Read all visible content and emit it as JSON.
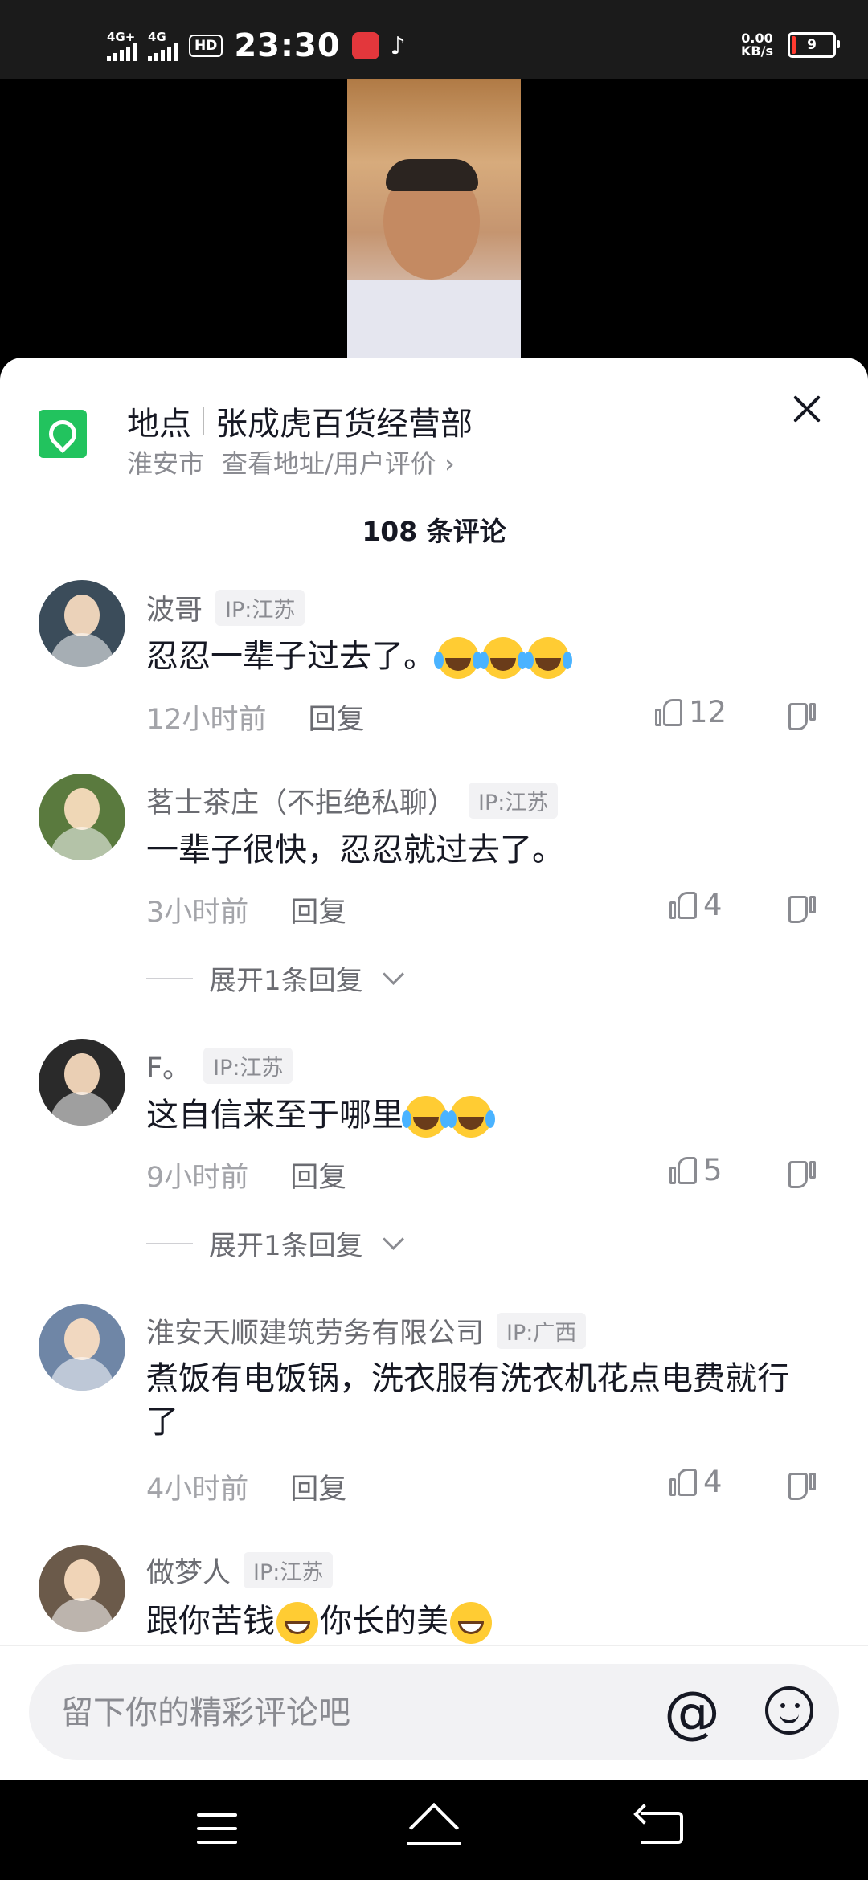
{
  "status_bar": {
    "signal1_label": "4G+",
    "signal2_label": "4G",
    "hd_label": "HD",
    "time": "23:30",
    "net_speed_value": "0.00",
    "net_speed_unit": "KB/s",
    "battery_level": "9"
  },
  "location": {
    "label": "地点",
    "name": "张成虎百货经营部",
    "city": "淮安市",
    "detail_link": "查看地址/用户评价",
    "chevron": "›",
    "icon": "location-pin-icon",
    "icon_color": "#22c35e"
  },
  "comments_count": "108 条评论",
  "comments": [
    {
      "user": "波哥",
      "ip": "IP:江苏",
      "text": "忍忍一辈子过去了。",
      "emoji": [
        "cry",
        "cry",
        "cry"
      ],
      "time": "12小时前",
      "reply_label": "回复",
      "likes": "12",
      "avatar_color": "#3b4c5a"
    },
    {
      "user": "茗士茶庄（不拒绝私聊）",
      "ip": "IP:江苏",
      "text": "一辈子很快，忍忍就过去了。",
      "emoji": [],
      "time": "3小时前",
      "reply_label": "回复",
      "likes": "4",
      "expand": "展开1条回复",
      "avatar_color": "#5a7a3e"
    },
    {
      "user": "F。",
      "ip": "IP:江苏",
      "text": "这自信来至于哪里",
      "emoji": [
        "cry",
        "cry"
      ],
      "time": "9小时前",
      "reply_label": "回复",
      "likes": "5",
      "expand": "展开1条回复",
      "avatar_color": "#2a2a2a"
    },
    {
      "user": "淮安天顺建筑劳务有限公司",
      "ip": "IP:广西",
      "text": "煮饭有电饭锅，洗衣服有洗衣机花点电费就行了",
      "emoji": [],
      "time": "4小时前",
      "reply_label": "回复",
      "likes": "4",
      "avatar_color": "#6f86a6"
    },
    {
      "user": "做梦人",
      "ip": "IP:江苏",
      "text_part1": "跟你苦钱",
      "text_part2": "你长的美",
      "emoji": [
        "grin",
        "grin"
      ],
      "avatar_color": "#6b5a4a"
    }
  ],
  "input": {
    "placeholder": "留下你的精彩评论吧",
    "at_symbol": "@"
  }
}
